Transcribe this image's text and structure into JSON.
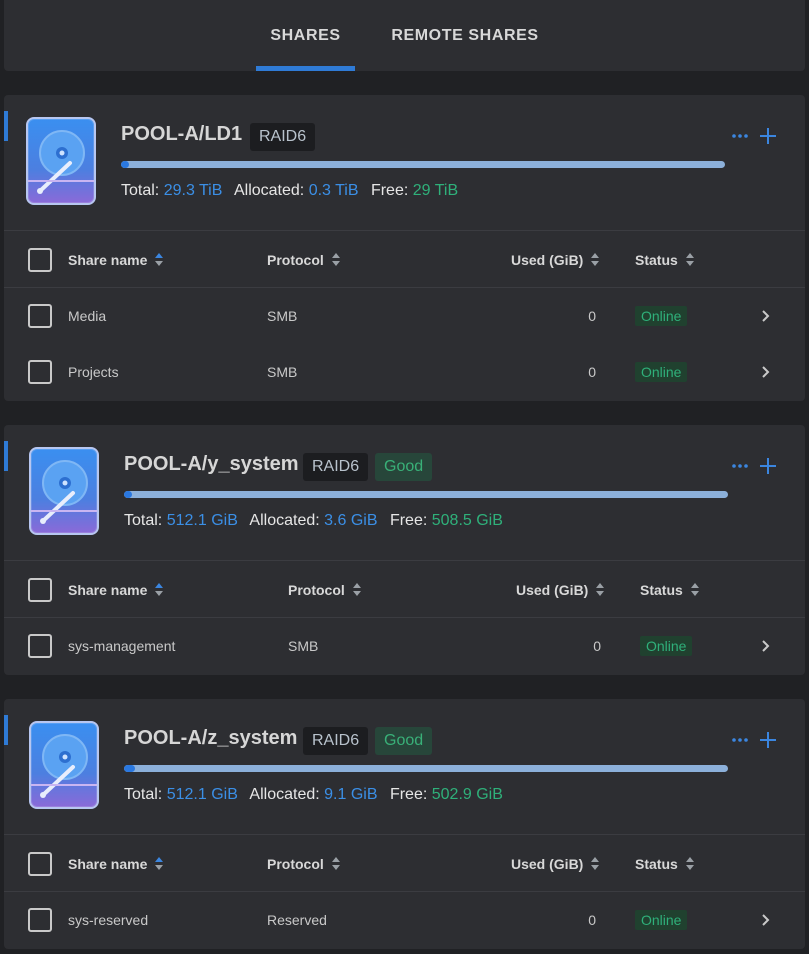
{
  "tabs": [
    {
      "label": "SHARES",
      "active": true
    },
    {
      "label": "REMOTE SHARES",
      "active": false
    }
  ],
  "colors": {
    "accent": "#2f7bd6",
    "online": "#2fb07a",
    "background": "#202124",
    "card": "#2d2e32"
  },
  "pools": [
    {
      "name": "POOL-A/LD1",
      "raid": "RAID6",
      "health": null,
      "usage_fraction": 0.01,
      "total_label": "Total:",
      "total": "29.3 TiB",
      "allocated_label": "Allocated:",
      "allocated": "0.3 TiB",
      "free_label": "Free:",
      "free": "29 TiB",
      "columns": {
        "name": "Share name",
        "protocol": "Protocol",
        "used": "Used (GiB)",
        "status": "Status"
      },
      "shares": [
        {
          "name": "Media",
          "protocol": "SMB",
          "used": "0",
          "status": "Online"
        },
        {
          "name": "Projects",
          "protocol": "SMB",
          "used": "0",
          "status": "Online"
        }
      ]
    },
    {
      "name": "POOL-A/y_system",
      "raid": "RAID6",
      "health": "Good",
      "usage_fraction": 0.007,
      "total_label": "Total:",
      "total": "512.1 GiB",
      "allocated_label": "Allocated:",
      "allocated": "3.6 GiB",
      "free_label": "Free:",
      "free": "508.5 GiB",
      "columns": {
        "name": "Share name",
        "protocol": "Protocol",
        "used": "Used (GiB)",
        "status": "Status"
      },
      "shares": [
        {
          "name": "sys-management",
          "protocol": "SMB",
          "used": "0",
          "status": "Online"
        }
      ]
    },
    {
      "name": "POOL-A/z_system",
      "raid": "RAID6",
      "health": "Good",
      "usage_fraction": 0.018,
      "total_label": "Total:",
      "total": "512.1 GiB",
      "allocated_label": "Allocated:",
      "allocated": "9.1 GiB",
      "free_label": "Free:",
      "free": "502.9 GiB",
      "columns": {
        "name": "Share name",
        "protocol": "Protocol",
        "used": "Used (GiB)",
        "status": "Status"
      },
      "shares": [
        {
          "name": "sys-reserved",
          "protocol": "Reserved",
          "used": "0",
          "status": "Online"
        }
      ]
    }
  ]
}
